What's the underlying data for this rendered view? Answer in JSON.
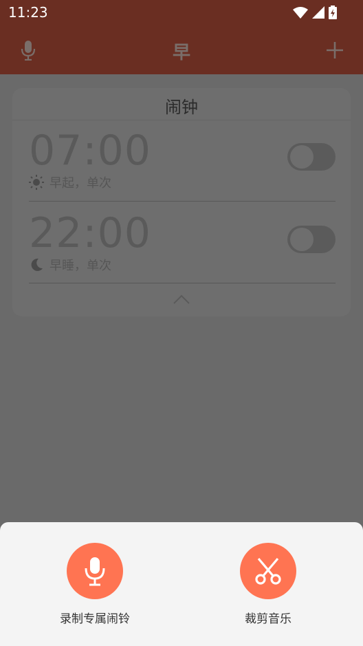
{
  "status_bar": {
    "time": "11:23"
  },
  "app_bar": {
    "title": "早"
  },
  "card": {
    "title": "闹钟",
    "alarms": [
      {
        "time": "07:00",
        "icon": "sun-icon",
        "label": "早起，单次",
        "enabled": false
      },
      {
        "time": "22:00",
        "icon": "moon-icon",
        "label": "早睡，单次",
        "enabled": false
      }
    ]
  },
  "sheet": {
    "actions": [
      {
        "icon": "microphone-icon",
        "label": "录制专属闹铃"
      },
      {
        "icon": "scissors-icon",
        "label": "裁剪音乐"
      }
    ]
  },
  "colors": {
    "app_bar_bg": "#6a2e22",
    "overlay_bg": "#6a6a6a",
    "accent": "#ff7452",
    "sheet_bg": "#f4f4f4"
  }
}
